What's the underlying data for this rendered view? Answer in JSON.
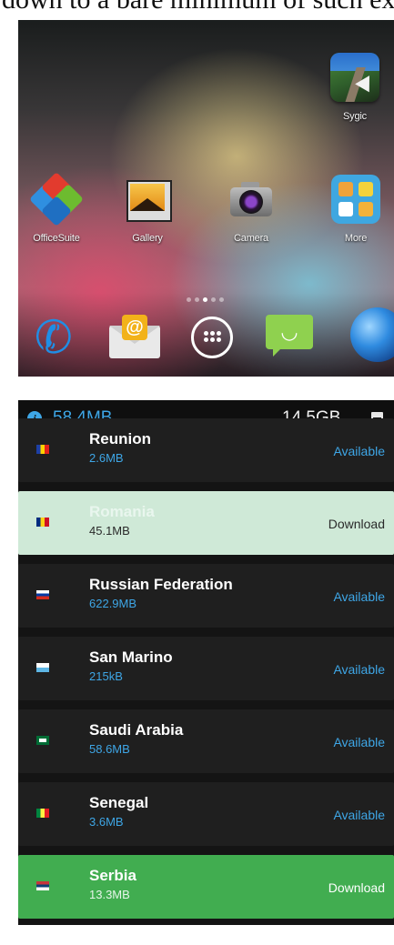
{
  "caption": "down to a bare minimum of such extrans.",
  "home": {
    "apps": [
      {
        "label": "Sygic"
      },
      {
        "label": "OfficeSuite"
      },
      {
        "label": "Gallery"
      },
      {
        "label": "Camera"
      },
      {
        "label": "More"
      }
    ],
    "page_indicator": {
      "pages": 5,
      "current": 3
    },
    "dock": [
      "phone-icon",
      "email-icon",
      "app-drawer-icon",
      "messaging-icon",
      "browser-icon"
    ]
  },
  "downloads": {
    "status": {
      "memory": "58.4MB",
      "storage": "14.5GB"
    },
    "colors": {
      "accent": "#3ea6e6",
      "selected_row": "#cfe9d7",
      "downloading_row": "#41ad50",
      "row_bg": "#1f1f1f"
    },
    "countries": [
      {
        "name": "Reunion",
        "size": "2.6MB",
        "state": "Available"
      },
      {
        "name": "Romania",
        "size": "45.1MB",
        "state": "Download"
      },
      {
        "name": "Russian Federation",
        "size": "622.9MB",
        "state": "Available"
      },
      {
        "name": "San Marino",
        "size": "215kB",
        "state": "Available"
      },
      {
        "name": "Saudi Arabia",
        "size": "58.6MB",
        "state": "Available"
      },
      {
        "name": "Senegal",
        "size": "3.6MB",
        "state": "Available"
      },
      {
        "name": "Serbia",
        "size": "13.3MB",
        "state": "Download"
      }
    ]
  }
}
